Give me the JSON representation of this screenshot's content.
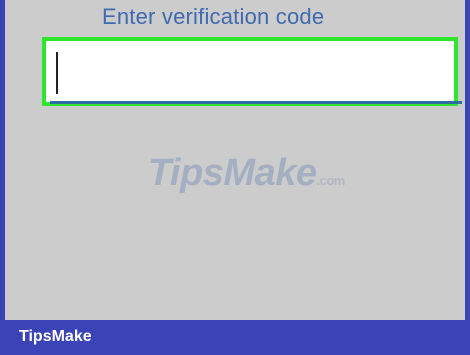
{
  "prompt": {
    "label": "Enter verification code"
  },
  "code_input": {
    "value": ""
  },
  "watermark": {
    "name": "TipsMake",
    "suffix": ".com"
  },
  "footer": {
    "brand": "TipsMake"
  },
  "colors": {
    "frame": "#3b44b6",
    "screen_background": "#cccccc",
    "highlight": "#2ee62e",
    "prompt_text": "#3f6ab0",
    "input_underline": "#2f6fa0"
  }
}
